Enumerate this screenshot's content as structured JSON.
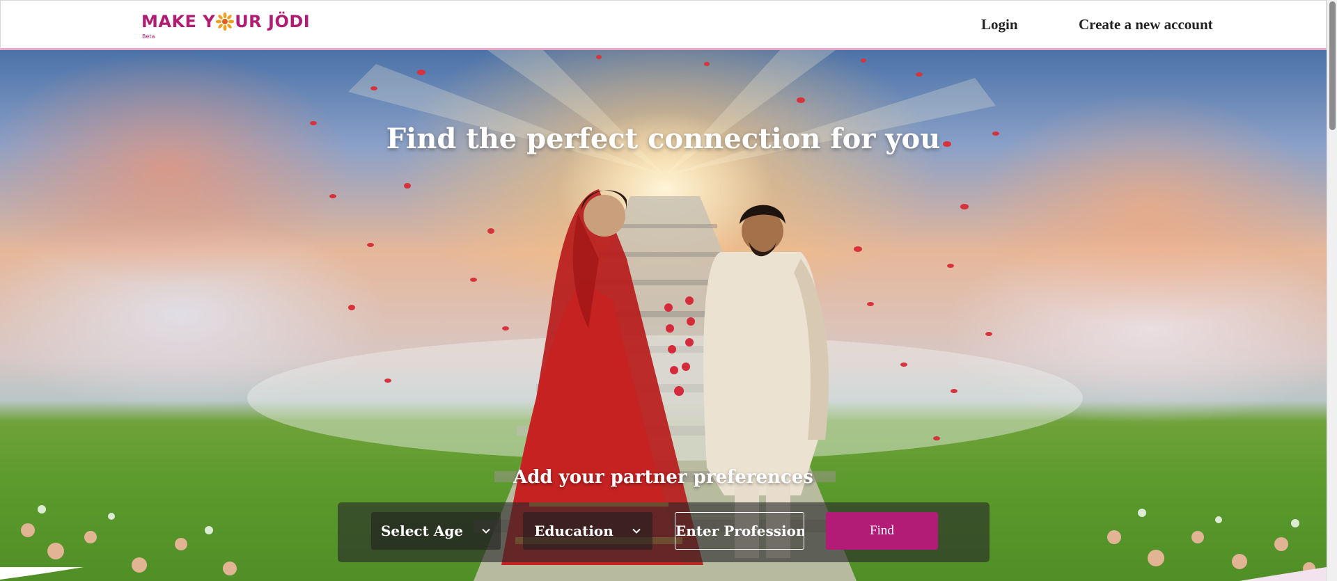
{
  "header": {
    "logo_text_left": "MAKE Y",
    "logo_text_right": "UR JÖDI",
    "logo_beta": "Beta",
    "login_label": "Login",
    "create_account_label": "Create a new account"
  },
  "hero": {
    "title": "Find the perfect connection for you",
    "preferences_title": "Add your partner preferences",
    "age_select": {
      "selected": "Select Age"
    },
    "education_select": {
      "selected": "Education"
    },
    "profession_input": {
      "placeholder": "Enter Profession",
      "value": ""
    },
    "find_button_label": "Find"
  },
  "colors": {
    "brand": "#b01e74",
    "find_button": "#b21c76",
    "header_border": "#e9a8c8"
  },
  "icons": [
    "flower-logo-icon",
    "chevron-down-icon"
  ]
}
